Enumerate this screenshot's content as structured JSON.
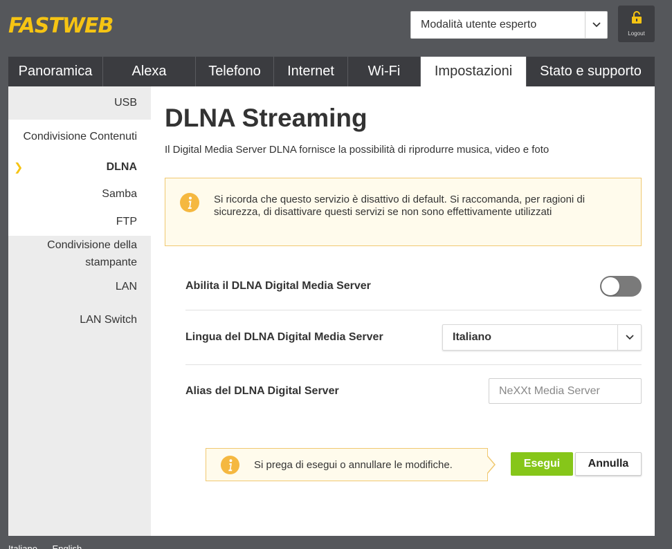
{
  "header": {
    "logo_text": "FASTWEB",
    "mode_select_value": "Modalità utente esperto",
    "logout_label": "Logout"
  },
  "tabs": [
    {
      "label": "Panoramica"
    },
    {
      "label": "Alexa"
    },
    {
      "label": "Telefono"
    },
    {
      "label": "Internet"
    },
    {
      "label": "Wi-Fi"
    },
    {
      "label": "Impostazioni",
      "active": true
    },
    {
      "label": "Stato e supporto"
    }
  ],
  "sidebar": {
    "items": [
      {
        "label": "USB"
      },
      {
        "label": "Condivisione Contenuti"
      },
      {
        "label": "DLNA",
        "active": true
      },
      {
        "label": "Samba"
      },
      {
        "label": "FTP"
      },
      {
        "label": "Condivisione della stampante"
      },
      {
        "label": "LAN"
      },
      {
        "label": "LAN Switch"
      }
    ],
    "active_marker": "❯"
  },
  "main": {
    "title": "DLNA Streaming",
    "subtitle": "Il Digital Media Server DLNA fornisce la possibilità di riprodurre musica, video e foto",
    "notice": "Si ricorda che questo servizio è disattivo di default. Si raccomanda, per ragioni di sicurezza, di disattivare questi servizi se non sono effettivamente utilizzati",
    "enable_label": "Abilita il DLNA Digital Media Server",
    "enable_state": "off",
    "language_label": "Lingua del DLNA Digital Media Server",
    "language_value": "Italiano",
    "alias_label": "Alias del DLNA Digital Server",
    "alias_placeholder": "NeXXt Media Server",
    "pending_message": "Si prega di esegui o annullare le modifiche.",
    "execute_label": "Esegui",
    "cancel_label": "Annulla"
  },
  "footer": {
    "languages": [
      "Italiano",
      "English"
    ]
  },
  "colors": {
    "background": "#55575b",
    "brand_yellow": "#f6c413",
    "tab_bar": "#3b3c40",
    "execute_green": "#86c619",
    "notice_bg": "#fffbec",
    "notice_border": "#f0c870",
    "info_icon": "#f5b840"
  },
  "icons": {
    "info": "info-icon",
    "lock": "lock-icon",
    "chevron": "chevron-down-icon"
  }
}
